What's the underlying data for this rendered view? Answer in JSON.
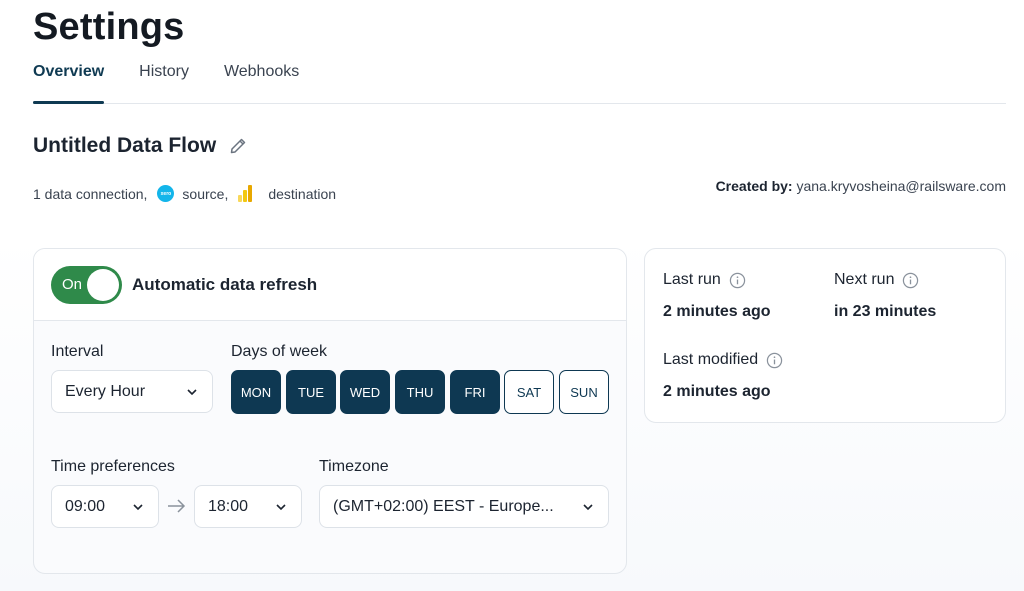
{
  "page": {
    "title": "Settings"
  },
  "tabs": [
    {
      "label": "Overview",
      "active": true
    },
    {
      "label": "History",
      "active": false
    },
    {
      "label": "Webhooks",
      "active": false
    }
  ],
  "flow": {
    "name": "Untitled Data Flow",
    "connections_prefix": "1 data connection,",
    "source_label": "source,",
    "source_logo_text": "xero",
    "destination_label": "destination",
    "created_by_label": "Created by:",
    "created_by_value": "yana.kryvosheina@railsware.com"
  },
  "refresh": {
    "toggle_label": "On",
    "title": "Automatic data refresh",
    "interval_label": "Interval",
    "interval_value": "Every Hour",
    "days_label": "Days of week",
    "days": [
      {
        "label": "MON",
        "selected": true
      },
      {
        "label": "TUE",
        "selected": true
      },
      {
        "label": "WED",
        "selected": true
      },
      {
        "label": "THU",
        "selected": true
      },
      {
        "label": "FRI",
        "selected": true
      },
      {
        "label": "SAT",
        "selected": false
      },
      {
        "label": "SUN",
        "selected": false
      }
    ],
    "time_label": "Time preferences",
    "time_from": "09:00",
    "time_to": "18:00",
    "timezone_label": "Timezone",
    "timezone_value": "(GMT+02:00) EEST - Europe..."
  },
  "status": {
    "last_run_label": "Last run",
    "last_run_value": "2 minutes ago",
    "next_run_label": "Next run",
    "next_run_value": "in 23 minutes",
    "last_modified_label": "Last modified",
    "last_modified_value": "2 minutes ago"
  },
  "colors": {
    "accent": "#0e3852",
    "toggle_on": "#2f8a4a",
    "xero": "#13b5ea",
    "powerbi": "#f2c811"
  },
  "icons": {
    "edit": "pencil-icon",
    "source": "xero-logo-icon",
    "destination": "power-bi-logo-icon",
    "info": "info-icon",
    "dropdown": "chevron-down-icon",
    "range": "arrow-right-icon"
  }
}
